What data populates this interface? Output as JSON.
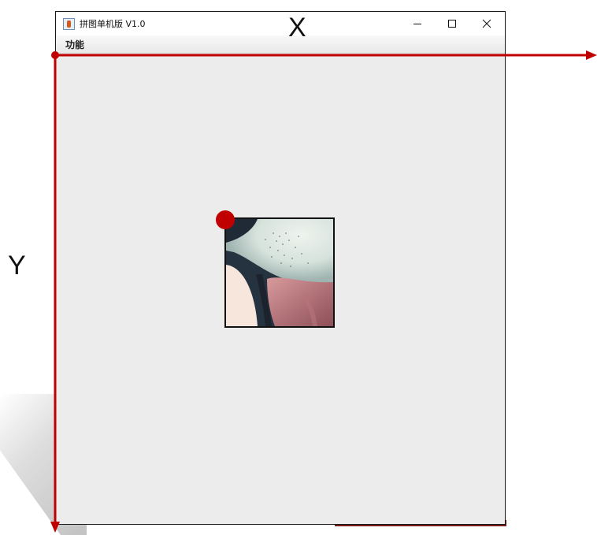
{
  "window": {
    "title": "拼图单机版 V1.0",
    "controls": {
      "minimize": "minimize-icon",
      "maximize": "maximize-icon",
      "close": "close-icon"
    }
  },
  "menubar": {
    "items": [
      {
        "label": "功能"
      }
    ]
  },
  "puzzle": {
    "tile_icon": "puzzle-tile-image"
  },
  "annotation": {
    "x_label": "X",
    "y_label": "Y",
    "color": "#c00000"
  }
}
